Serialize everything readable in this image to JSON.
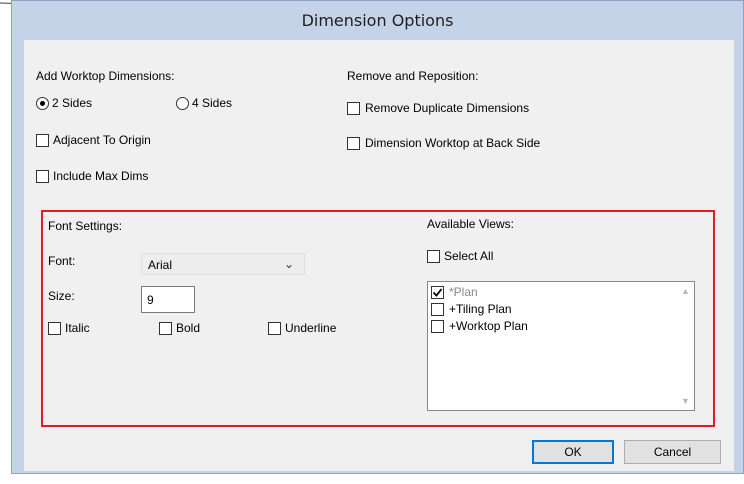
{
  "dialog": {
    "title": "Dimension Options"
  },
  "worktop": {
    "heading": "Add Worktop Dimensions:",
    "two_sides": {
      "label": "2 Sides",
      "selected": true
    },
    "four_sides": {
      "label": "4 Sides",
      "selected": false
    },
    "adjacent": {
      "label": "Adjacent To Origin",
      "checked": false
    },
    "include_max": {
      "label": "Include Max Dims",
      "checked": false
    }
  },
  "remove": {
    "heading": "Remove and Reposition:",
    "remove_duplicate": {
      "label": "Remove Duplicate Dimensions",
      "checked": false
    },
    "back_side": {
      "label": "Dimension Worktop at Back Side",
      "checked": false
    }
  },
  "font_settings": {
    "heading": "Font Settings:",
    "font_label": "Font:",
    "font_value": "Arial",
    "size_label": "Size:",
    "size_value": "9",
    "italic": {
      "label": "Italic",
      "checked": false
    },
    "bold": {
      "label": "Bold",
      "checked": false
    },
    "underline": {
      "label": "Underline",
      "checked": false
    }
  },
  "views": {
    "heading": "Available Views:",
    "select_all": {
      "label": "Select All",
      "checked": false
    },
    "items": [
      {
        "label": "*Plan",
        "checked": true
      },
      {
        "label": "+Tiling Plan",
        "checked": false
      },
      {
        "label": "+Worktop Plan",
        "checked": false
      }
    ]
  },
  "buttons": {
    "ok": "OK",
    "cancel": "Cancel"
  },
  "colors": {
    "highlight_border": "#e01b24",
    "title_bg": "#c5d3e8",
    "default_button": "#0078d7"
  }
}
